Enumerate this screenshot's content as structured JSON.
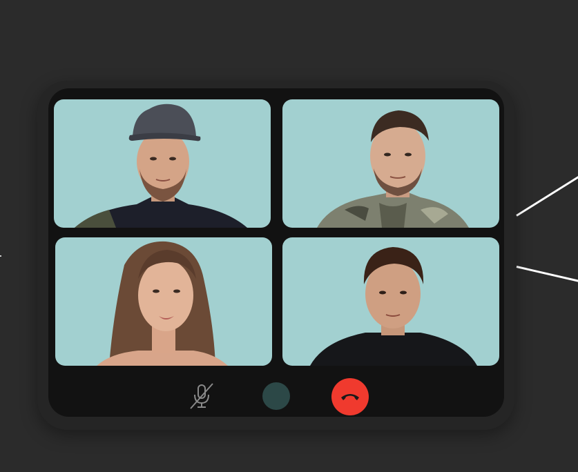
{
  "call": {
    "participants": [
      {
        "id": "p1",
        "icon": "participant-video-1",
        "attire": "cap-dark-tshirt"
      },
      {
        "id": "p2",
        "icon": "participant-video-2",
        "attire": "camo-hoodie"
      },
      {
        "id": "p3",
        "icon": "participant-video-3",
        "attire": "long-hair"
      },
      {
        "id": "p4",
        "icon": "participant-video-4",
        "attire": "black-sweater"
      }
    ],
    "tile_background": "#a2d0d0"
  },
  "controls": {
    "mute": {
      "icon": "mic-off-icon",
      "state": "muted"
    },
    "middle": {
      "icon": "circle-button",
      "color": "#2c4847"
    },
    "end_call": {
      "icon": "phone-hangup-icon",
      "color": "#f03a2e"
    }
  },
  "colors": {
    "background": "#2b2b2b",
    "device": "#252525",
    "screen": "#121212",
    "connector": "#ffffff"
  }
}
